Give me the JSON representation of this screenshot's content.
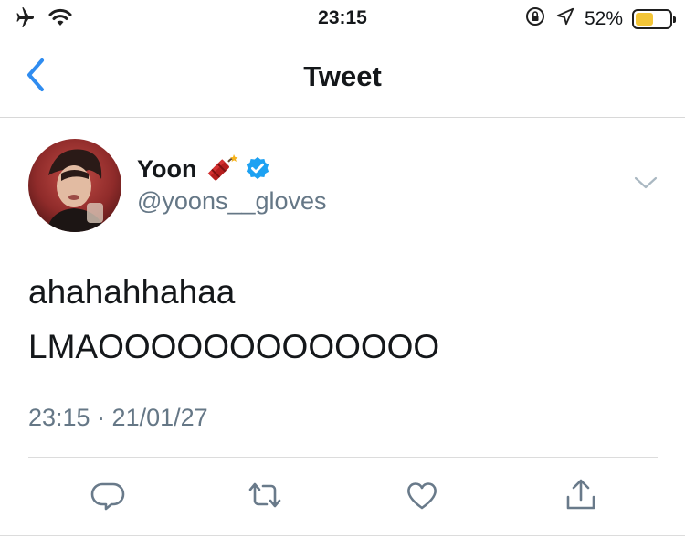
{
  "status_bar": {
    "time": "23:15",
    "battery_percent": "52%",
    "battery_level": 0.52,
    "icons": [
      "airplane-icon",
      "wifi-icon",
      "orientation-lock-icon",
      "location-icon",
      "battery-icon"
    ]
  },
  "nav": {
    "title": "Tweet",
    "back_icon": "chevron-left-icon"
  },
  "tweet": {
    "author_name": "Yoon",
    "author_emoji": "firecracker-icon",
    "verified": true,
    "handle": "@yoons__gloves",
    "text_lines": [
      "ahahahhahaa",
      "LMAOOOOOOOOOOOOO"
    ],
    "timestamp": "23:15 · 21/01/27"
  },
  "actions": [
    "reply-icon",
    "retweet-icon",
    "like-icon",
    "share-icon"
  ],
  "colors": {
    "accent": "#1da1f2",
    "back": "#2f8cf0",
    "secondary_text": "#657786",
    "action_icon": "#697a8a",
    "battery_fill": "#f3c537"
  }
}
